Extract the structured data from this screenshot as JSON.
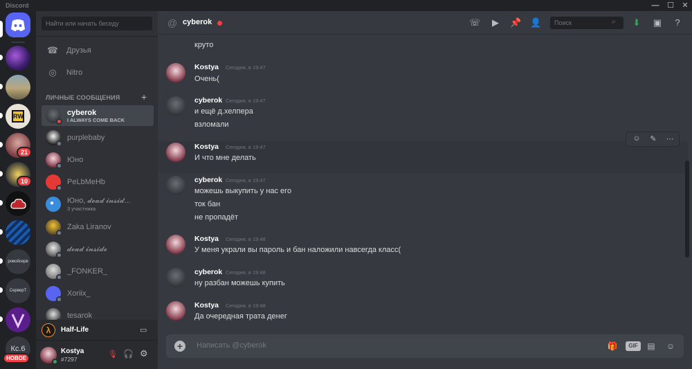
{
  "window": {
    "title": "Discord",
    "minimize": "—",
    "maximize": "☐",
    "close": "✕"
  },
  "servers": {
    "badge_21": "21",
    "badge_10": "10",
    "server_text_1": "ровойсерв",
    "server_text_2": "СерверТ",
    "server_text_3": "Кс.6",
    "new_badge": "НОВОЕ"
  },
  "dms": {
    "search_placeholder": "Найти или начать беседу",
    "friends_label": "Друзья",
    "nitro_label": "Nitro",
    "section_header": "ЛИЧНЫЕ СООБЩЕНИЯ",
    "add": "+",
    "items": [
      {
        "name": "cyberok",
        "sub": "I ALWAYS COME BACK"
      },
      {
        "name": "purplebaby",
        "sub": ""
      },
      {
        "name": "Юно",
        "sub": ""
      },
      {
        "name": "PeLbMeHb",
        "sub": ""
      },
      {
        "name": "Юно, 𝓭𝓮𝓪𝓭 𝓲𝓷𝓼𝓲𝓭...",
        "sub": "3 участника"
      },
      {
        "name": "Zaka Liranov",
        "sub": ""
      },
      {
        "name": "𝓭𝓮𝓪𝓭 𝓲𝓷𝓼𝓲𝓭𝓮",
        "sub": ""
      },
      {
        "name": "_FONKER_",
        "sub": ""
      },
      {
        "name": "Xoriix_",
        "sub": ""
      },
      {
        "name": "tesarok",
        "sub": ""
      }
    ],
    "activity": "Half-Life"
  },
  "user": {
    "name": "Kostya",
    "tag": "#7297"
  },
  "chat": {
    "recipient": "cyberok",
    "search_placeholder": "Поиск",
    "composer_placeholder": "Написать @cyberok",
    "gif": "GIF",
    "messages": [
      {
        "lines": [
          "круто"
        ]
      },
      {
        "author": "Kostya",
        "time": "Сегодня, в 19:47",
        "lines": [
          "Очень("
        ]
      },
      {
        "author": "cyberok",
        "time": "Сегодня, в 19:47",
        "lines": [
          "и ещё д.хелпера",
          "взломали"
        ]
      },
      {
        "author": "Kostya",
        "time": "Сегодня, в 19:47",
        "lines": [
          "И что мне делать"
        ]
      },
      {
        "author": "cyberok",
        "time": "Сегодня, в 19:47",
        "lines": [
          "можешь выкупить у нас его",
          "ток бан",
          "не пропадёт"
        ]
      },
      {
        "author": "Kostya",
        "time": "Сегодня, в 19:48",
        "lines": [
          "У меня украли вы пароль и бан наложили навсегда класс("
        ]
      },
      {
        "author": "cyberok",
        "time": "Сегодня, в 19:48",
        "lines": [
          "ну разбан можешь купить"
        ]
      },
      {
        "author": "Kostya",
        "time": "Сегодня, в 19:48",
        "lines": [
          "Да очередная трата денег"
        ]
      }
    ]
  },
  "colors": {
    "brand": "#5865f2",
    "danger": "#ed4245",
    "download": "#3ba55d",
    "dark_bg": "#202225",
    "channel_bg": "#2f3136",
    "chat_bg": "#36393f"
  }
}
